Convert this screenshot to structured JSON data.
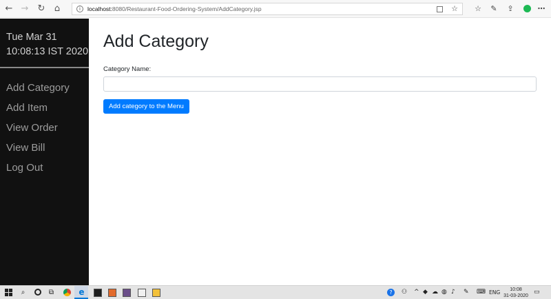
{
  "browser": {
    "url_host": "localhost:",
    "url_path": "8080/Restaurant-Food-Ordering-System/AddCategory.jsp",
    "icons": {
      "back": "arrow-left-icon",
      "forward": "arrow-right-icon",
      "reload": "reload-icon",
      "home": "home-icon",
      "info": "info-icon",
      "reader": "reader-view-icon",
      "favorite": "star-icon",
      "favorites_bar": "favorites-icon",
      "pen": "pen-icon",
      "share": "share-icon",
      "extension": "grammarly-icon",
      "more": "more-icon"
    }
  },
  "sidebar": {
    "date_line": "Tue Mar 31",
    "time_line": "10:08:13 IST 2020",
    "items": [
      {
        "label": "Add Category"
      },
      {
        "label": "Add Item"
      },
      {
        "label": "View Order"
      },
      {
        "label": "View Bill"
      },
      {
        "label": "Log Out"
      }
    ]
  },
  "main": {
    "title": "Add Category",
    "field_label": "Category Name:",
    "field_value": "",
    "submit_label": "Add category to the Menu"
  },
  "taskbar": {
    "lang": "ENG",
    "time": "10:08",
    "date": "31-03-2020",
    "colors": {
      "edge": "#0078d7",
      "accent": "#007bff",
      "sidebar_bg": "#111111"
    }
  }
}
